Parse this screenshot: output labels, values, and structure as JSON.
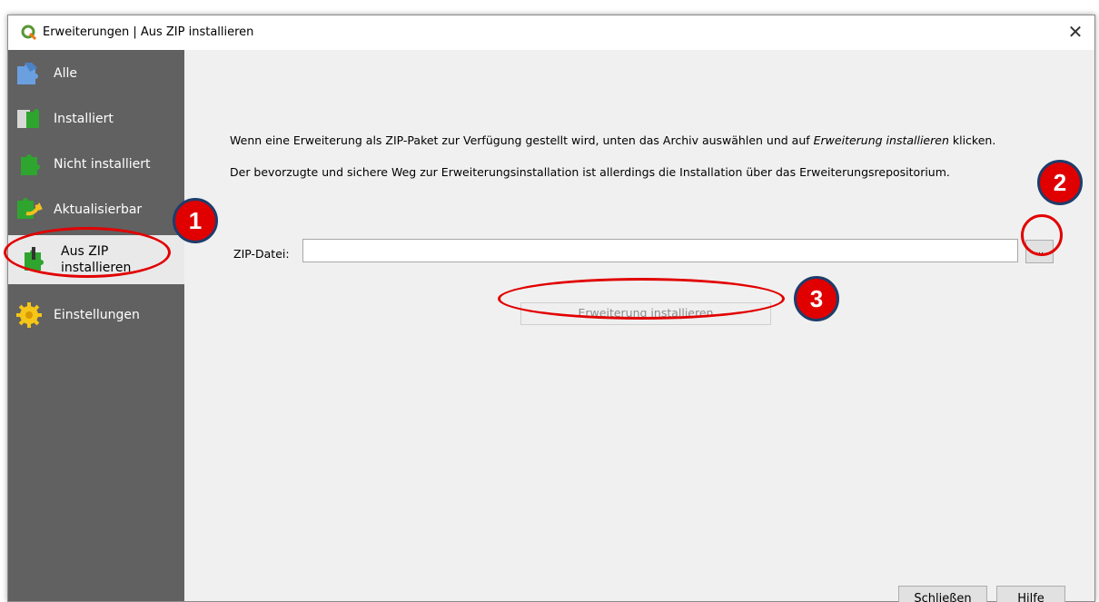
{
  "window": {
    "title": "Erweiterungen | Aus ZIP installieren",
    "close_glyph": "✕"
  },
  "sidebar": {
    "items": [
      {
        "label": "Alle",
        "icon": "puzzle-all-icon"
      },
      {
        "label": "Installiert",
        "icon": "puzzle-installed-icon"
      },
      {
        "label": "Nicht installiert",
        "icon": "puzzle-not-installed-icon"
      },
      {
        "label": "Aktualisierbar",
        "icon": "puzzle-upgradeable-icon"
      },
      {
        "label_line1": "Aus ZIP",
        "label_line2": "installieren",
        "icon": "puzzle-zip-icon",
        "selected": true
      },
      {
        "label": "Einstellungen",
        "icon": "gear-icon"
      }
    ]
  },
  "content": {
    "desc1_pre": "Wenn eine Erweiterung als ZIP-Paket zur Verfügung gestellt wird, unten das Archiv auswählen und auf ",
    "desc1_em": "Erweiterung installieren",
    "desc1_post": " klicken.",
    "desc2": "Der bevorzugte und sichere Weg zur Erweiterungsinstallation ist allerdings die Installation über das Erweiterungsrepositorium.",
    "zip_label": "ZIP-Datei:",
    "zip_value": "",
    "browse_label": "...",
    "install_label": "Erweiterung installieren"
  },
  "footer": {
    "close_label": "Schließen",
    "help_label": "Hilfe"
  },
  "annotations": {
    "badge1": "1",
    "badge2": "2",
    "badge3": "3"
  },
  "colors": {
    "sidebar_bg": "#616161",
    "annotation_red": "#e00000",
    "badge_border": "#1d3d6b"
  }
}
